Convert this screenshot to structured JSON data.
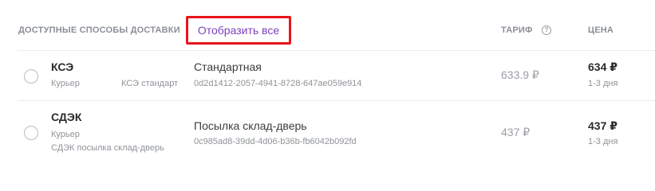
{
  "header": {
    "methods_label": "ДОСТУПНЫЕ СПОСОБЫ ДОСТАВКИ",
    "show_all": "Отобразить все",
    "tariff_label": "ТАРИФ",
    "help_glyph": "?",
    "price_label": "ЦЕНА"
  },
  "rows": [
    {
      "carrier": "КСЭ",
      "type": "Курьер",
      "service": "КСЭ стандарт",
      "method": "Стандартная",
      "uuid": "0d2d1412-2057-4941-8728-647ae059e914",
      "tariff": "633.9 ₽",
      "price": "634 ₽",
      "days": "1-3 дня"
    },
    {
      "carrier": "СДЭК",
      "type": "Курьер",
      "service": "СДЭК посылка склад-дверь",
      "method": "Посылка склад-дверь",
      "uuid": "0c985ad8-39dd-4d06-b36b-fb6042b092fd",
      "tariff": "437 ₽",
      "price": "437 ₽",
      "days": "1-3 дня"
    }
  ],
  "colors": {
    "highlight_border": "#e8141b",
    "link": "#7b3fbf"
  }
}
